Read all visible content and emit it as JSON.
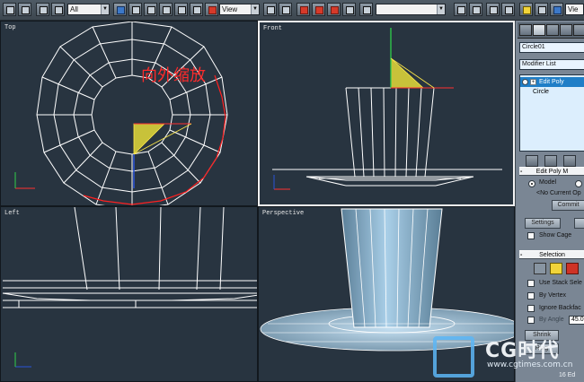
{
  "toolbar": {
    "selection_filter": "All",
    "coord_system": "View",
    "named_selection": "",
    "render_preset": "Vie",
    "icons": [
      "undo-icon",
      "redo-icon",
      "link-icon",
      "unlink-icon",
      "bind-icon",
      "select-icon",
      "select-by-name-icon",
      "rect-select-icon",
      "window-crossing-icon",
      "move-icon",
      "rotate-icon",
      "scale-icon",
      "pivot-icon",
      "mirror-icon",
      "align-icon",
      "snap-icon",
      "angle-snap-icon",
      "percent-snap-icon",
      "spinner-snap-icon",
      "edit-named-icon",
      "curve-editor-icon",
      "schematic-icon",
      "material-editor-icon",
      "render-setup-icon",
      "quick-render-icon"
    ]
  },
  "viewports": {
    "top": {
      "label": "Top",
      "annotation": "向外缩放"
    },
    "front": {
      "label": "Front"
    },
    "left": {
      "label": "Left"
    },
    "perspective": {
      "label": "Perspective"
    }
  },
  "command_panel": {
    "object_name": "Circle01",
    "modifier_list": "Modifier List",
    "stack": [
      "Edit Poly",
      "Circle"
    ],
    "edit_poly_rollout": "Edit Poly M",
    "model_radio": "Model",
    "current_op": "<No Current Op",
    "commit_button": "Commit",
    "settings_button": "Settings",
    "show_cage_label": "Show Cage",
    "selection_rollout": "Selection",
    "use_stack_label": "Use Stack Sele",
    "by_vertex_label": "By Vertex",
    "ignore_backface_label": "Ignore Backfac",
    "by_angle_label": "By Angle",
    "angle_value": "45.0",
    "shrink_button": "Shrink",
    "ring_button": "Ring",
    "status_text": "16 Ed"
  },
  "watermark": {
    "brand": "CG时代",
    "url": "www.cgtimes.com.cn"
  },
  "colors": {
    "viewport_bg": "#283440",
    "wire": "#ffffff",
    "annotation_red": "#ff2020",
    "gizmo_yellow": "#c8c23a",
    "accent_blue": "#1f7ec7"
  }
}
